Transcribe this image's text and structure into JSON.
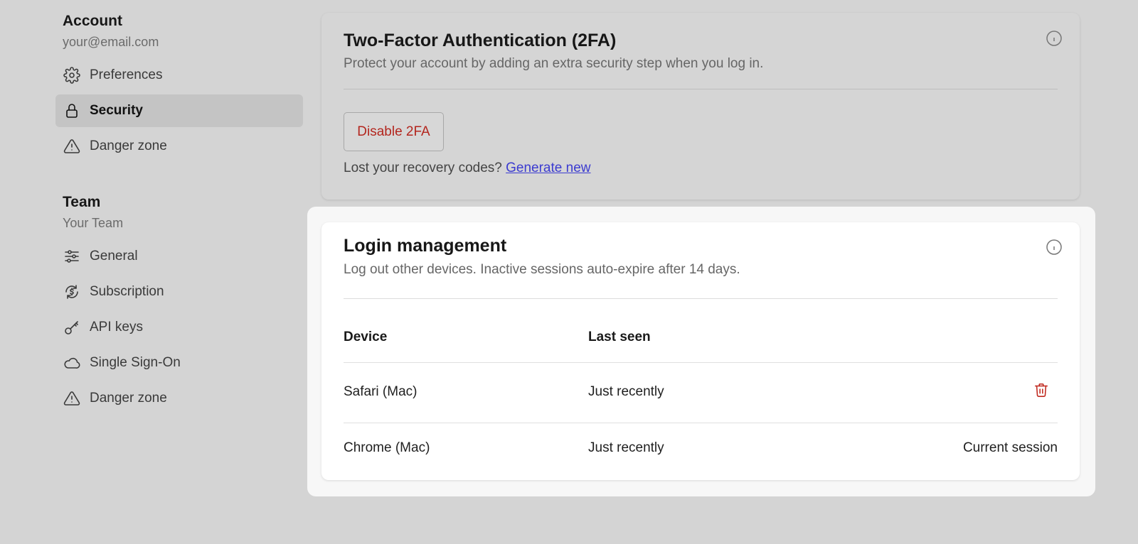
{
  "sidebar": {
    "account": {
      "title": "Account",
      "subtitle": "your@email.com",
      "items": [
        {
          "label": "Preferences",
          "icon": "gear-icon"
        },
        {
          "label": "Security",
          "icon": "lock-icon",
          "active": true
        },
        {
          "label": "Danger zone",
          "icon": "warning-icon"
        }
      ]
    },
    "team": {
      "title": "Team",
      "subtitle": "Your Team",
      "items": [
        {
          "label": "General",
          "icon": "sliders-icon"
        },
        {
          "label": "Subscription",
          "icon": "subscription-icon"
        },
        {
          "label": "API keys",
          "icon": "key-icon"
        },
        {
          "label": "Single Sign-On",
          "icon": "cloud-icon"
        },
        {
          "label": "Danger zone",
          "icon": "warning-icon"
        }
      ]
    }
  },
  "two_factor": {
    "title": "Two-Factor Authentication (2FA)",
    "description": "Protect your account by adding an extra security step when you log in.",
    "disable_button": "Disable 2FA",
    "recovery_text": "Lost your recovery codes?",
    "recovery_link": "Generate new"
  },
  "login_management": {
    "title": "Login management",
    "description": "Log out other devices. Inactive sessions auto-expire after 14 days.",
    "columns": {
      "device": "Device",
      "last_seen": "Last seen"
    },
    "rows": [
      {
        "device": "Safari (Mac)",
        "last_seen": "Just recently",
        "action": "delete"
      },
      {
        "device": "Chrome (Mac)",
        "last_seen": "Just recently",
        "status": "Current session"
      }
    ]
  },
  "colors": {
    "background": "#d4d4d4",
    "active_nav": "#c4c4c4",
    "danger": "#b3261e",
    "link": "#3b3bd0"
  }
}
